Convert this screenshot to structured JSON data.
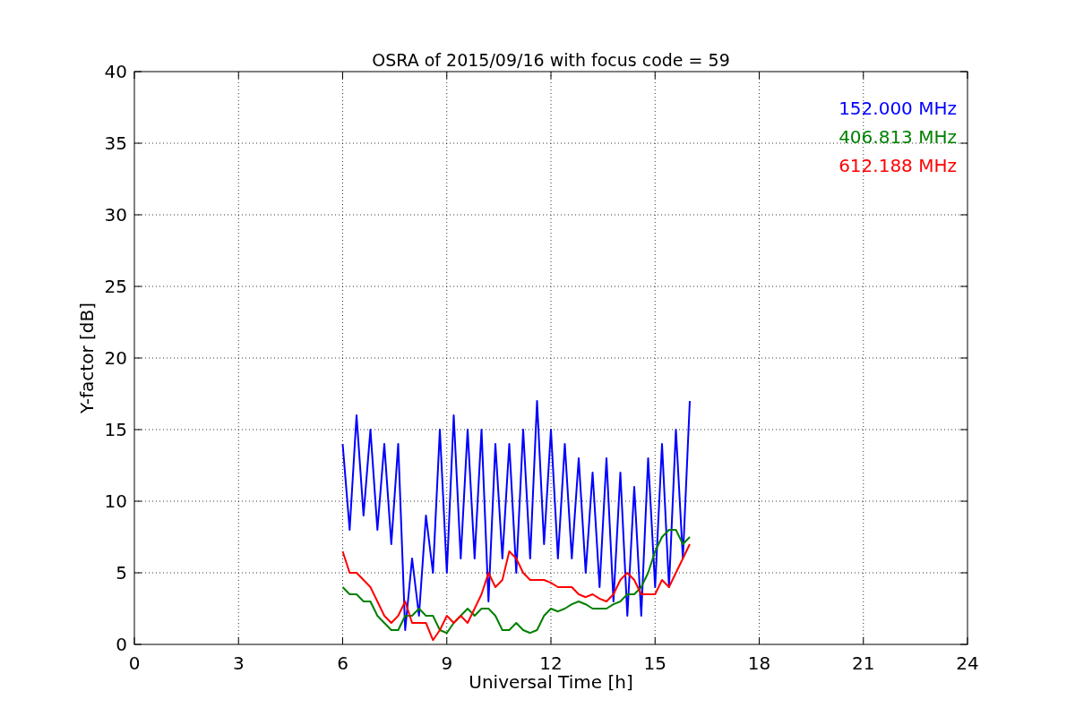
{
  "chart_data": {
    "type": "line",
    "title": "OSRA of 2015/09/16 with focus code = 59",
    "xlabel": "Universal Time [h]",
    "ylabel": "Y-factor [dB]",
    "x": [
      6.0,
      6.2,
      6.4,
      6.6,
      6.8,
      7.0,
      7.2,
      7.4,
      7.6,
      7.8,
      8.0,
      8.2,
      8.4,
      8.6,
      8.8,
      9.0,
      9.2,
      9.4,
      9.6,
      9.8,
      10.0,
      10.2,
      10.4,
      10.6,
      10.8,
      11.0,
      11.2,
      11.4,
      11.6,
      11.8,
      12.0,
      12.2,
      12.4,
      12.6,
      12.8,
      13.0,
      13.2,
      13.4,
      13.6,
      13.8,
      14.0,
      14.2,
      14.4,
      14.6,
      14.8,
      15.0,
      15.2,
      15.4,
      15.6,
      15.8,
      16.0
    ],
    "series": [
      {
        "name": "152.000 MHz",
        "color": "#0000ff",
        "values": [
          14,
          8,
          16,
          9,
          15,
          8,
          14,
          7,
          14,
          1,
          6,
          2,
          9,
          5,
          15,
          5,
          16,
          6,
          15,
          6,
          15,
          3,
          14,
          6,
          14,
          5,
          15,
          6,
          17,
          7,
          15,
          6,
          14,
          6,
          13,
          5,
          12,
          4,
          13,
          3,
          12,
          2,
          11,
          2,
          13,
          4,
          14,
          4,
          15,
          6,
          17
        ]
      },
      {
        "name": "406.813 MHz",
        "color": "#008000",
        "values": [
          4,
          3.5,
          3.5,
          3,
          3,
          2,
          1.5,
          1,
          1,
          2,
          2,
          2.5,
          2,
          2,
          1,
          0.8,
          1.5,
          2,
          2.5,
          2,
          2.5,
          2.5,
          2,
          1,
          1,
          1.5,
          1,
          0.8,
          1,
          2,
          2.5,
          2.3,
          2.5,
          2.8,
          3,
          2.8,
          2.5,
          2.5,
          2.5,
          2.8,
          3,
          3.5,
          3.5,
          4,
          5,
          6.5,
          7.5,
          8,
          8,
          7,
          7.5
        ]
      },
      {
        "name": "612.188 MHz",
        "color": "#ff0000",
        "values": [
          6.5,
          5,
          5,
          4.5,
          4,
          3,
          2,
          1.5,
          2,
          3,
          1.5,
          1.5,
          1.5,
          0.3,
          1,
          2,
          1.5,
          2,
          1.5,
          2.5,
          3.5,
          5,
          4,
          4.5,
          6.5,
          6,
          5,
          4.5,
          4.5,
          4.5,
          4.3,
          4,
          4,
          4,
          3.5,
          3.3,
          3.5,
          3.2,
          3,
          3.5,
          4.5,
          5,
          4.5,
          3.5,
          3.5,
          3.5,
          4.5,
          4,
          5,
          6,
          7
        ]
      }
    ],
    "grid": true,
    "xlim": [
      0,
      24
    ],
    "ylim": [
      0,
      40
    ],
    "xticks": [
      0,
      3,
      6,
      9,
      12,
      15,
      18,
      21,
      24
    ],
    "yticks": [
      0,
      5,
      10,
      15,
      20,
      25,
      30,
      35,
      40
    ]
  }
}
